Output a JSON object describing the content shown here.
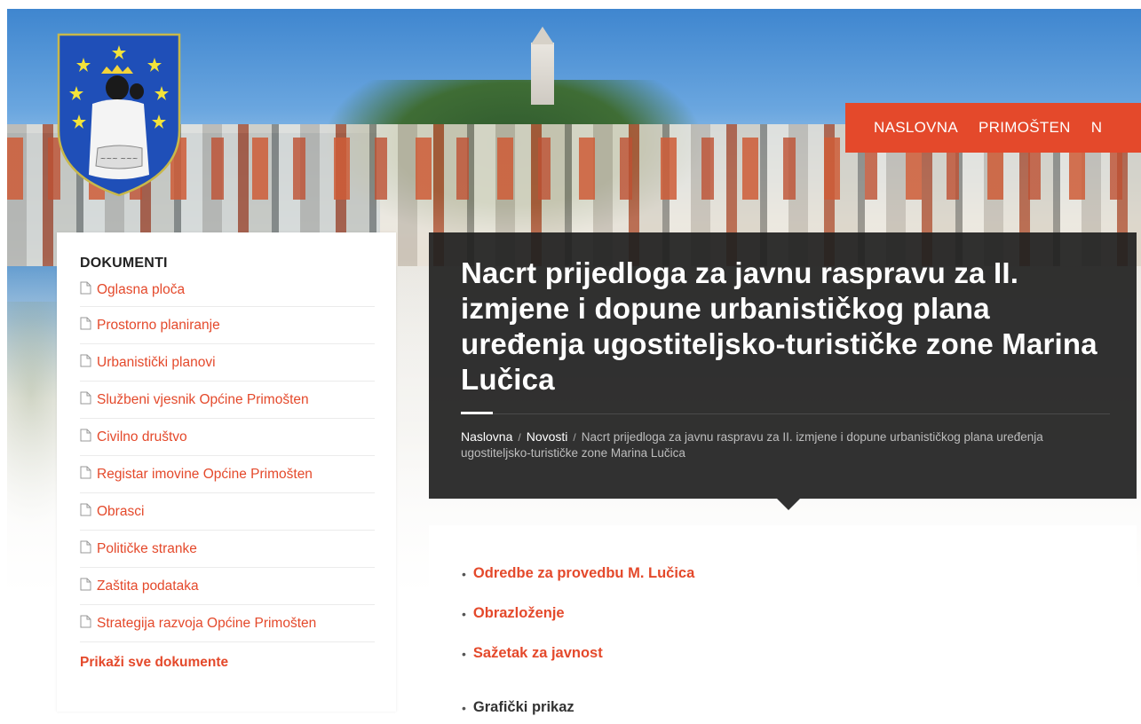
{
  "nav": {
    "items": [
      "NASLOVNA",
      "PRIMOŠTEN",
      "N"
    ]
  },
  "sidebar": {
    "title": "DOKUMENTI",
    "items": [
      "Oglasna ploča",
      "Prostorno planiranje",
      "Urbanistički planovi",
      "Službeni vjesnik Općine Primošten",
      "Civilno društvo",
      "Registar imovine Općine Primošten",
      "Obrasci",
      "Političke stranke",
      "Zaštita podataka",
      "Strategija razvoja Općine Primošten"
    ],
    "show_all": "Prikaži sve dokumente"
  },
  "article": {
    "title": "Nacrt prijedloga za javnu raspravu za II. izmjene i dopune urbanističkog plana uređenja ugostiteljsko-turističke zone Marina Lučica"
  },
  "breadcrumb": {
    "home": "Naslovna",
    "section": "Novosti",
    "separator": "/",
    "current": "Nacrt prijedloga za javnu raspravu za II. izmjene i dopune urbanističkog plana uređenja ugostiteljsko-turističke zone Marina Lučica"
  },
  "content": {
    "links": [
      "Odredbe za provedbu M. Lučica",
      "Obrazloženje",
      "Sažetak za javnost"
    ],
    "extra": "Grafički prikaz",
    "bullet": "•"
  },
  "colors": {
    "accent": "#e4492b",
    "panel": "#202020",
    "text_dark": "#222222"
  },
  "icons": {
    "document": "document-icon",
    "crest": "coat-of-arms-logo"
  }
}
